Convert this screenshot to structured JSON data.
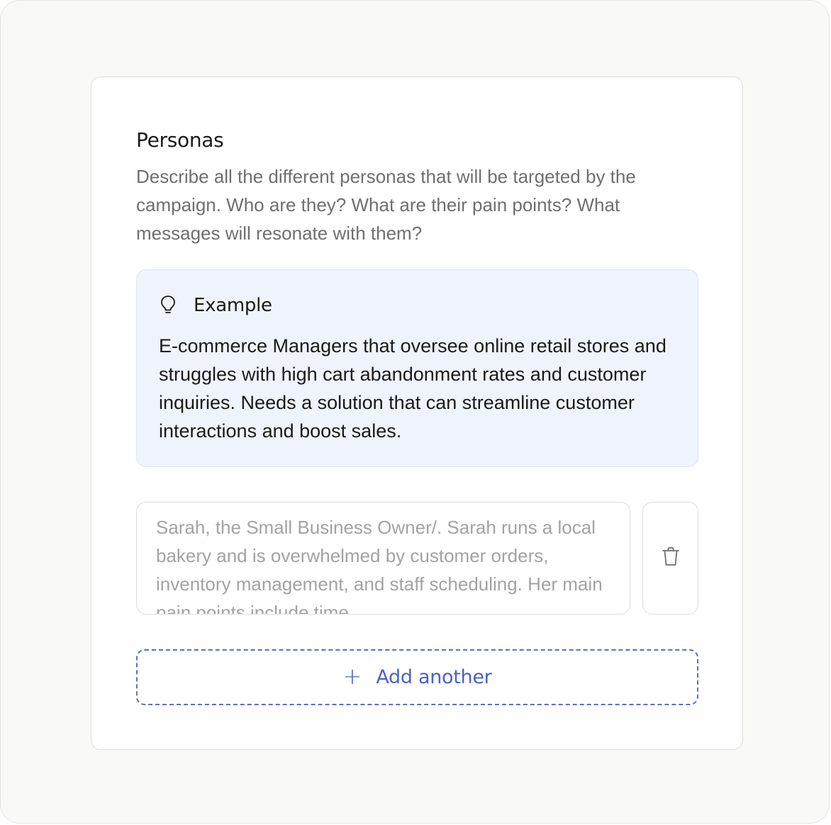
{
  "section": {
    "title": "Personas",
    "description": "Describe all the different personas that will be targeted by the campaign. Who are they? What are their pain points? What messages will resonate with them?"
  },
  "example": {
    "icon": "lightbulb-icon",
    "label": "Example",
    "text": "E-commerce Managers that oversee online retail stores and struggles with high cart abandonment rates and customer inquiries.  Needs a solution that can streamline customer interactions and boost sales."
  },
  "personas": [
    {
      "text": "Sarah, the Small Business Owner/. Sarah runs a local bakery and is overwhelmed by customer orders, inventory management, and staff scheduling. Her main pain points include time",
      "delete_icon": "trash-icon"
    }
  ],
  "add_another": {
    "icon": "plus-icon",
    "label": "Add another"
  },
  "colors": {
    "accent": "#4b62c0",
    "example_bg": "#eff3fb"
  }
}
